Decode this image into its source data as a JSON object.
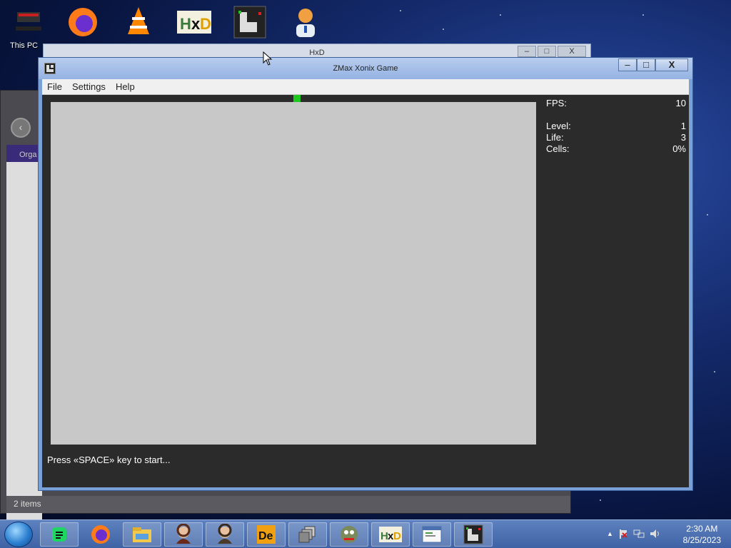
{
  "desktop": {
    "icon_label": "This PC",
    "icons": [
      "this-pc-icon",
      "firefox-icon",
      "vlc-icon",
      "hxd-icon",
      "xonix-icon",
      "user-icon"
    ]
  },
  "background_window": {
    "organize_label": "Orga",
    "status_text": "2 items"
  },
  "hxd_window": {
    "title": "HxD",
    "minimize": "–",
    "maximize": "□",
    "close": "X"
  },
  "game_window": {
    "title": "ZMax Xonix Game",
    "controls": {
      "minimize": "–",
      "maximize": "□",
      "close": "X"
    },
    "menu": [
      "File",
      "Settings",
      "Help"
    ],
    "stats": {
      "fps_label": "FPS:",
      "fps_value": "10",
      "level_label": "Level:",
      "level_value": "1",
      "life_label": "Life:",
      "life_value": "3",
      "cells_label": "Cells:",
      "cells_value": "0%"
    },
    "message": "Press «SPACE» key to start...",
    "colors": {
      "field": "#c8c8c8",
      "player": "#1ec81e",
      "background": "#2b2b2b"
    }
  },
  "taskbar": {
    "apps": [
      "start-button",
      "spotify-icon",
      "firefox-icon",
      "file-explorer-icon",
      "app-portrait-icon",
      "app-portrait-icon-2",
      "de-icon",
      "windows-icon",
      "gimp-icon",
      "hxd-icon",
      "notepad-icon",
      "xonix-icon"
    ],
    "tray_arrow": "▲",
    "clock_time": "2:30 AM",
    "clock_date": "8/25/2023"
  }
}
